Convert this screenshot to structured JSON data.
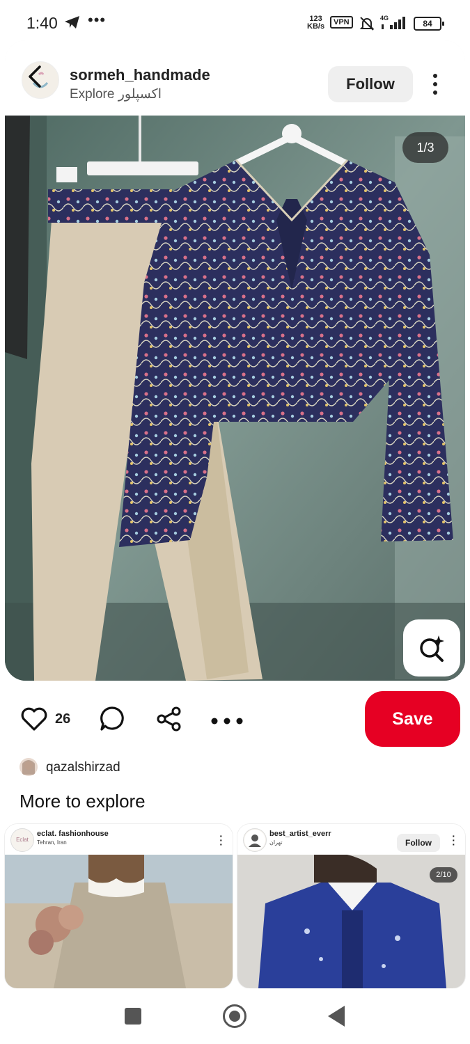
{
  "status_bar": {
    "time": "1:40",
    "net_speed_value": "123",
    "net_speed_unit": "KB/s",
    "vpn": "VPN",
    "network": "4G",
    "battery": "84"
  },
  "pin_header": {
    "username": "sormeh_handmade",
    "subtitle": "Explore اکسپلور",
    "follow_label": "Follow"
  },
  "photo": {
    "counter": "1/3",
    "description_icon": "visual-search-icon"
  },
  "actions": {
    "like_count": "26",
    "save_label": "Save"
  },
  "pinner": {
    "name": "qazalshirzad"
  },
  "more_to_explore": {
    "title": "More to explore",
    "cards": [
      {
        "avatar_text": "Eclat",
        "name": "eclat. fashionhouse",
        "location": "Tehran, Iran"
      },
      {
        "name": "best_artist_everr",
        "location": "تهران",
        "follow_label": "Follow",
        "counter": "2/10"
      }
    ]
  },
  "colors": {
    "save": "#e60023",
    "jacket_navy": "#2c2f5e",
    "pants_beige": "#d8cbb4"
  }
}
